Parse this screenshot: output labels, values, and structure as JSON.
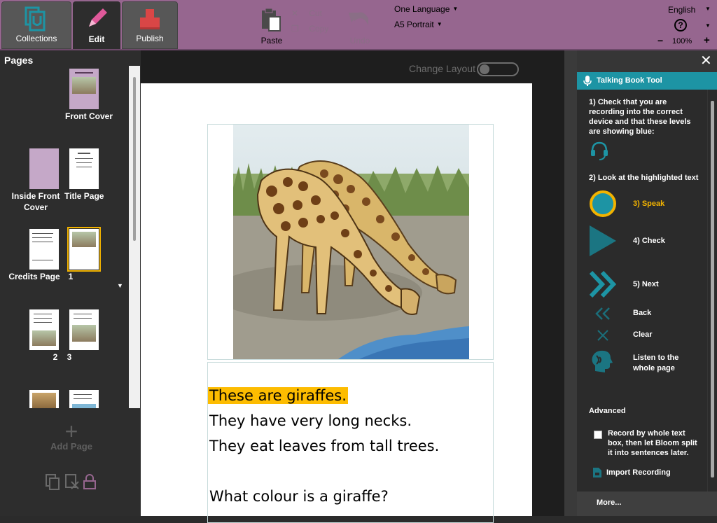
{
  "toolbar": {
    "tabs": [
      {
        "label": "Collections",
        "icon": "collections-icon"
      },
      {
        "label": "Edit",
        "icon": "pencil-icon"
      },
      {
        "label": "Publish",
        "icon": "publish-icon"
      }
    ],
    "paste": "Paste",
    "cut": "Cut",
    "copy": "Copy",
    "undo": "Undo",
    "language_dropdown": "One Language",
    "size_dropdown": "A5 Portrait",
    "ui_language": "English",
    "help": "?",
    "zoom_out": "−",
    "zoom": "100%",
    "zoom_in": "+"
  },
  "pages_panel": {
    "title": "Pages",
    "thumbnails": [
      {
        "label": "Front Cover"
      },
      {
        "label": "Inside Front Cover"
      },
      {
        "label": "Title Page"
      },
      {
        "label": "Credits Page"
      },
      {
        "label": "1"
      },
      {
        "label": "2"
      },
      {
        "label": "3"
      }
    ],
    "add_page": "Add Page",
    "tools": [
      "duplicate-page-icon",
      "delete-page-icon",
      "lock-icon"
    ]
  },
  "editor": {
    "change_layout": "Change Layout",
    "text_lines": [
      "These are giraffes.",
      "They have very long necks.",
      "They eat leaves from tall trees.",
      "What colour is a giraffe?"
    ]
  },
  "tool": {
    "title": "Talking Book Tool",
    "instruction1": "1) Check that you are recording into the correct device and that these levels are showing blue:",
    "instruction2": "2) Look at the highlighted text",
    "speak": "3) Speak",
    "check": "4) Check",
    "next": "5) Next",
    "back": "Back",
    "clear": "Clear",
    "listen": "Listen to the whole page",
    "advanced": "Advanced",
    "record_whole": "Record by whole text box, then let Bloom split it into sentences later.",
    "import": "Import Recording",
    "more": "More..."
  },
  "colors": {
    "toolbar": "#96668f",
    "accent": "#1d94a4",
    "highlight": "#fdbc00",
    "selected_outline": "#f2b300"
  }
}
